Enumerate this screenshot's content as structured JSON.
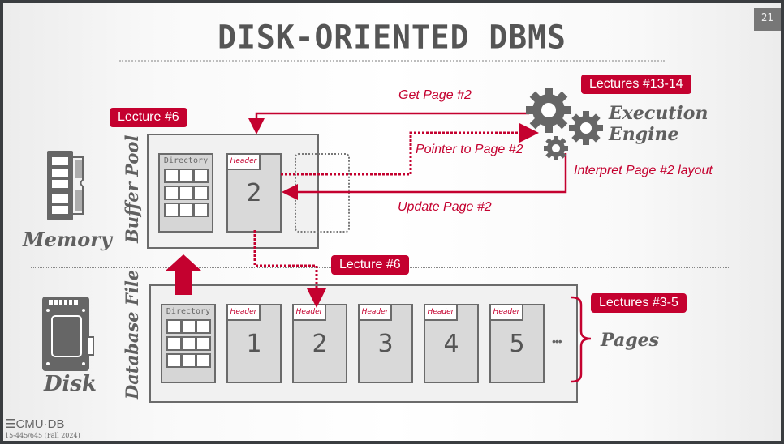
{
  "slide": {
    "title": "DISK-ORIENTED DBMS",
    "page_number": "21",
    "footer_logo": "CMU·DB",
    "footer_course": "15-445/645 (Fall 2024)"
  },
  "memory": {
    "label": "Memory",
    "icon": "ram-icon"
  },
  "disk": {
    "label": "Disk",
    "icon": "ssd-icon"
  },
  "buffer_pool": {
    "label": "Buffer Pool",
    "badge": "Lecture #6",
    "directory_label": "Directory",
    "page": {
      "header": "Header",
      "number": "2"
    }
  },
  "database_file": {
    "label": "Database File",
    "badge": "Lecture #6",
    "directory_label": "Directory",
    "pages": [
      {
        "header": "Header",
        "number": "1"
      },
      {
        "header": "Header",
        "number": "2"
      },
      {
        "header": "Header",
        "number": "3"
      },
      {
        "header": "Header",
        "number": "4"
      },
      {
        "header": "Header",
        "number": "5"
      }
    ],
    "ellipsis": "•••",
    "pages_label": "Pages",
    "pages_badge": "Lectures #3-5"
  },
  "execution_engine": {
    "label_line1": "Execution",
    "label_line2": "Engine",
    "badge": "Lectures #13-14",
    "icon": "gears-icon"
  },
  "arrows": {
    "get_page": "Get Page #2",
    "pointer": "Pointer to Page #2",
    "interpret": "Interpret Page #2 layout",
    "update": "Update Page #2"
  },
  "colors": {
    "accent": "#c4012f",
    "gray": "#6b6b6b"
  }
}
